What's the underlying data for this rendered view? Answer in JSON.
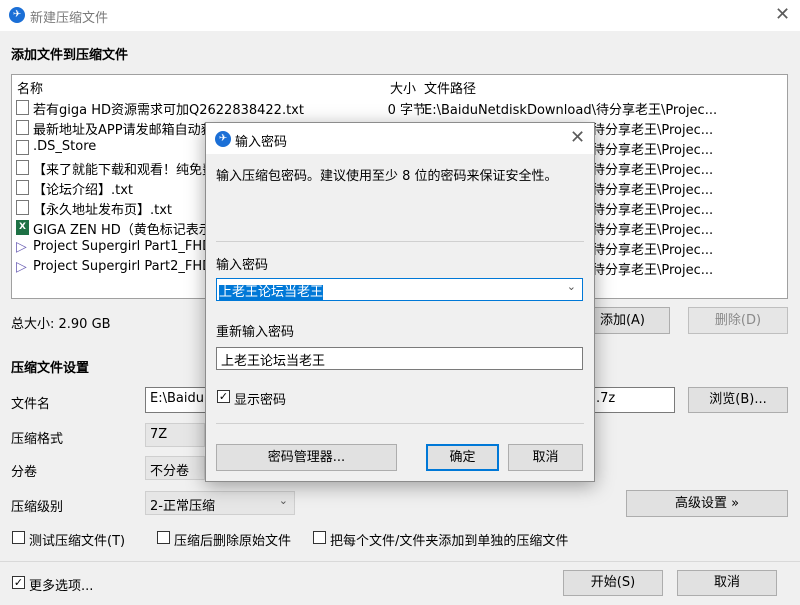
{
  "window": {
    "title": "新建压缩文件",
    "icon": "app-logo-icon"
  },
  "add_files": {
    "section_title": "添加文件到压缩文件",
    "columns": {
      "name": "名称",
      "size": "大小",
      "path": "文件路径"
    },
    "files": [
      {
        "name": "若有giga HD资源需求可加Q2622838422.txt",
        "size": "0 字节",
        "path": "E:\\BaiduNetdiskDownload\\待分享老王\\Projec...",
        "icon": "text-file-icon"
      },
      {
        "name": "最新地址及APP请发邮箱自动获取.txt",
        "size": "",
        "path": "待分享老王\\Projec...",
        "icon": "text-file-icon"
      },
      {
        "name": ".DS_Store",
        "size": "",
        "path": "待分享老王\\Projec...",
        "icon": "file-icon"
      },
      {
        "name": "【来了就能下载和观看！纯免费",
        "size": "",
        "path": "待分享老王\\Projec...",
        "icon": "text-file-icon"
      },
      {
        "name": "【论坛介绍】.txt",
        "size": "",
        "path": "待分享老王\\Projec...",
        "icon": "text-file-icon"
      },
      {
        "name": "【永久地址发布页】.txt",
        "size": "",
        "path": "待分享老王\\Projec...",
        "icon": "text-file-icon"
      },
      {
        "name": "GIGA ZEN HD（黄色标记表示",
        "size": "",
        "path": "待分享老王\\Projec...",
        "icon": "excel-file-icon"
      },
      {
        "name": "Project Supergirl Part1_FHD",
        "size": "",
        "path": "待分享老王\\Projec...",
        "icon": "video-file-icon"
      },
      {
        "name": "Project Supergirl Part2_FHD",
        "size": "",
        "path": "待分享老王\\Projec...",
        "icon": "video-file-icon"
      }
    ],
    "total_size_label": "总大小: 2.90 GB",
    "add_button": "添加(A)",
    "remove_button": "删除(D)"
  },
  "settings": {
    "section_title": "压缩文件设置",
    "filename_label": "文件名",
    "filename_value": "E:\\BaiduN",
    "filename_ext": ".7z",
    "browse_button": "浏览(B)...",
    "format_label": "压缩格式",
    "format_value": "7Z",
    "split_label": "分卷",
    "split_value": "不分卷",
    "level_label": "压缩级别",
    "level_value": "2-正常压缩",
    "advanced_button": "高级设置 »",
    "test_archive": {
      "label": "测试压缩文件(T)",
      "checked": false
    },
    "delete_after": {
      "label": "压缩后删除原始文件",
      "checked": false
    },
    "separate_archives": {
      "label": "把每个文件/文件夹添加到单独的压缩文件",
      "checked": false
    }
  },
  "footer": {
    "more_options": {
      "label": "更多选项...",
      "checked": true
    },
    "start_button": "开始(S)",
    "cancel_button": "取消"
  },
  "password_dialog": {
    "title": "输入密码",
    "description": "输入压缩包密码。建议使用至少 8 位的密码来保证安全性。",
    "password_label": "输入密码",
    "password_value": "上老王论坛当老王",
    "confirm_label": "重新输入密码",
    "confirm_value": "上老王论坛当老王",
    "show_password": {
      "label": "显示密码",
      "checked": true
    },
    "manager_button": "密码管理器...",
    "ok_button": "确定",
    "cancel_button": "取消",
    "accent_color": "#0078d7"
  }
}
